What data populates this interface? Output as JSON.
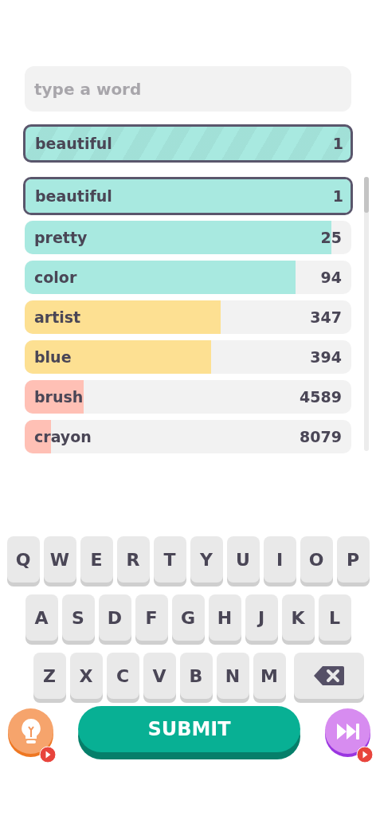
{
  "word_input": {
    "placeholder": "type a word"
  },
  "last_guess": {
    "word": "beautiful",
    "rank": "1",
    "color": "#a8e9e0"
  },
  "guesses": [
    {
      "word": "beautiful",
      "rank": "1",
      "level": 1,
      "color": "#a8e9e0",
      "selected": true
    },
    {
      "word": "pretty",
      "rank": "25",
      "level": 0.94,
      "color": "#a8e9e0",
      "selected": false
    },
    {
      "word": "color",
      "rank": "94",
      "level": 0.83,
      "color": "#a8e9e0",
      "selected": false
    },
    {
      "word": "artist",
      "rank": "347",
      "level": 0.6,
      "color": "#fde092",
      "selected": false
    },
    {
      "word": "blue",
      "rank": "394",
      "level": 0.57,
      "color": "#fde092",
      "selected": false
    },
    {
      "word": "brush",
      "rank": "4589",
      "level": 0.18,
      "color": "#ffc0b5",
      "selected": false
    },
    {
      "word": "crayon",
      "rank": "8079",
      "level": 0.08,
      "color": "#ffc0b5",
      "selected": false
    }
  ],
  "keyboard": [
    [
      {
        "kind": "letter",
        "label": "Q"
      },
      {
        "kind": "letter",
        "label": "W"
      },
      {
        "kind": "letter",
        "label": "E"
      },
      {
        "kind": "letter",
        "label": "R"
      },
      {
        "kind": "letter",
        "label": "T"
      },
      {
        "kind": "letter",
        "label": "Y"
      },
      {
        "kind": "letter",
        "label": "U"
      },
      {
        "kind": "letter",
        "label": "I"
      },
      {
        "kind": "letter",
        "label": "O"
      },
      {
        "kind": "letter",
        "label": "P"
      }
    ],
    [
      {
        "kind": "letter",
        "label": "A"
      },
      {
        "kind": "letter",
        "label": "S"
      },
      {
        "kind": "letter",
        "label": "D"
      },
      {
        "kind": "letter",
        "label": "F"
      },
      {
        "kind": "letter",
        "label": "G"
      },
      {
        "kind": "letter",
        "label": "H"
      },
      {
        "kind": "letter",
        "label": "J"
      },
      {
        "kind": "letter",
        "label": "K"
      },
      {
        "kind": "letter",
        "label": "L"
      }
    ],
    [
      {
        "kind": "letter",
        "label": "Z"
      },
      {
        "kind": "letter",
        "label": "X"
      },
      {
        "kind": "letter",
        "label": "C"
      },
      {
        "kind": "letter",
        "label": "V"
      },
      {
        "kind": "letter",
        "label": "B"
      },
      {
        "kind": "letter",
        "label": "N"
      },
      {
        "kind": "letter",
        "label": "M"
      },
      {
        "kind": "backspace"
      }
    ]
  ],
  "submit_button": {
    "label": "SUBMIT"
  }
}
